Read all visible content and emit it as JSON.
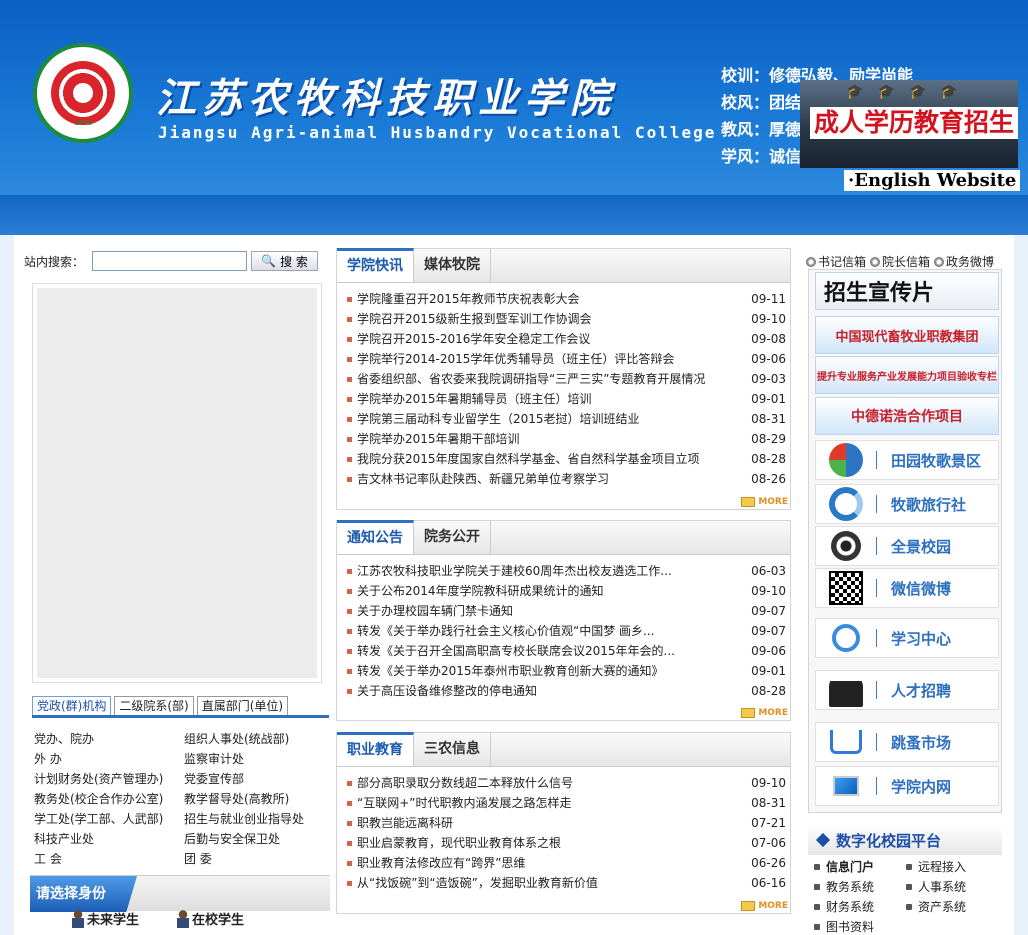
{
  "header": {
    "college_cn": "江苏农牧科技职业学院",
    "college_en": "Jiangsu Agri-animal Husbandry Vocational College",
    "logo_year": "1958",
    "motto": [
      "校训：修德弘毅、励学尚能",
      "校风：团结",
      "教风：厚德",
      "学风：诚信"
    ],
    "adult_edu": "成人学历教育招生",
    "english_link": "·English Website"
  },
  "search": {
    "label": "站内搜索：",
    "button": "搜 索",
    "value": ""
  },
  "org": {
    "tabs": [
      "党政(群)机构",
      "二级院系(部)",
      "直属部门(单位)"
    ],
    "items": [
      "党办、院办",
      "组织人事处(统战部)",
      "外 办",
      "监察审计处",
      "计划财务处(资产管理办)",
      "党委宣传部",
      "教务处(校企合作办公室)",
      "教学督导处(高教所)",
      "学工处(学工部、人武部)",
      "招生与就业创业指导处",
      "科技产业处",
      "后勤与安全保卫处",
      "工 会",
      "团 委"
    ]
  },
  "identity": {
    "label": "请选择身份",
    "items": [
      "未来学生",
      "在校学生"
    ]
  },
  "news": [
    {
      "tabs": [
        "学院快讯",
        "媒体牧院"
      ],
      "items": [
        {
          "t": "学院隆重召开2015年教师节庆祝表彰大会",
          "d": "09-11"
        },
        {
          "t": "学院召开2015级新生报到暨军训工作协调会",
          "d": "09-10"
        },
        {
          "t": "学院召开2015-2016学年安全稳定工作会议",
          "d": "09-08"
        },
        {
          "t": "学院举行2014-2015学年优秀辅导员（班主任）评比答辩会",
          "d": "09-06"
        },
        {
          "t": "省委组织部、省农委来我院调研指导“三严三实”专题教育开展情况",
          "d": "09-03"
        },
        {
          "t": "学院举办2015年暑期辅导员（班主任）培训",
          "d": "09-01"
        },
        {
          "t": "学院第三届动科专业留学生（2015老挝）培训班结业",
          "d": "08-31"
        },
        {
          "t": "学院举办2015年暑期干部培训",
          "d": "08-29"
        },
        {
          "t": "我院分获2015年度国家自然科学基金、省自然科学基金项目立项",
          "d": "08-28"
        },
        {
          "t": "吉文林书记率队赴陕西、新疆兄弟单位考察学习",
          "d": "08-26"
        }
      ],
      "more": "MORE"
    },
    {
      "tabs": [
        "通知公告",
        "院务公开"
      ],
      "items": [
        {
          "t": "江苏农牧科技职业学院关于建校60周年杰出校友遴选工作...",
          "d": "06-03"
        },
        {
          "t": "关于公布2014年度学院教科研成果统计的通知",
          "d": "09-10"
        },
        {
          "t": "关于办理校园车辆门禁卡通知",
          "d": "09-07"
        },
        {
          "t": "转发《关于举办践行社会主义核心价值观“中国梦 画乡...",
          "d": "09-07"
        },
        {
          "t": "转发《关于召开全国高职高专校长联席会议2015年年会的...",
          "d": "09-06"
        },
        {
          "t": "转发《关于举办2015年泰州市职业教育创新大赛的通知》",
          "d": "09-01"
        },
        {
          "t": "关于高压设备维修整改的停电通知",
          "d": "08-28"
        }
      ],
      "more": "MORE"
    },
    {
      "tabs": [
        "职业教育",
        "三农信息"
      ],
      "items": [
        {
          "t": "部分高职录取分数线超二本释放什么信号",
          "d": "09-10"
        },
        {
          "t": "“互联网+”时代职教内涵发展之路怎样走",
          "d": "08-31"
        },
        {
          "t": "职教岂能远离科研",
          "d": "07-21"
        },
        {
          "t": "职业启蒙教育，现代职业教育体系之根",
          "d": "07-06"
        },
        {
          "t": "职业教育法修改应有“跨界”思维",
          "d": "06-26"
        },
        {
          "t": "从“找饭碗”到“造饭碗”，发掘职业教育新价值",
          "d": "06-16"
        }
      ],
      "more": "MORE"
    }
  ],
  "right": {
    "links": [
      "书记信箱",
      "院长信箱",
      "政务微博"
    ],
    "banners": [
      "招生宣传片",
      "中国现代畜牧业职教集团",
      "提升专业服务产业发展能力项目验收专栏",
      "中德诺浩合作项目"
    ],
    "services": [
      {
        "label": "田园牧歌景区",
        "icon": "tianyuan-logo-icon"
      },
      {
        "label": "牧歌旅行社",
        "icon": "travel-logo-icon"
      },
      {
        "label": "全景校园",
        "icon": "panorama-lens-icon"
      },
      {
        "label": "微信微博",
        "icon": "qr-code-icon"
      },
      {
        "label": "学习中心",
        "icon": "study-magnifier-icon"
      },
      {
        "label": "人才招聘",
        "icon": "recruit-person-icon"
      },
      {
        "label": "跳蚤市场",
        "icon": "shopping-cart-icon"
      },
      {
        "label": "学院内网",
        "icon": "monitor-icon"
      }
    ],
    "digital_title": "数字化校园平台",
    "digital_items": [
      "信息门户",
      "远程接入",
      "教务系统",
      "人事系统",
      "财务系统",
      "资产系统",
      "图书资料"
    ]
  }
}
